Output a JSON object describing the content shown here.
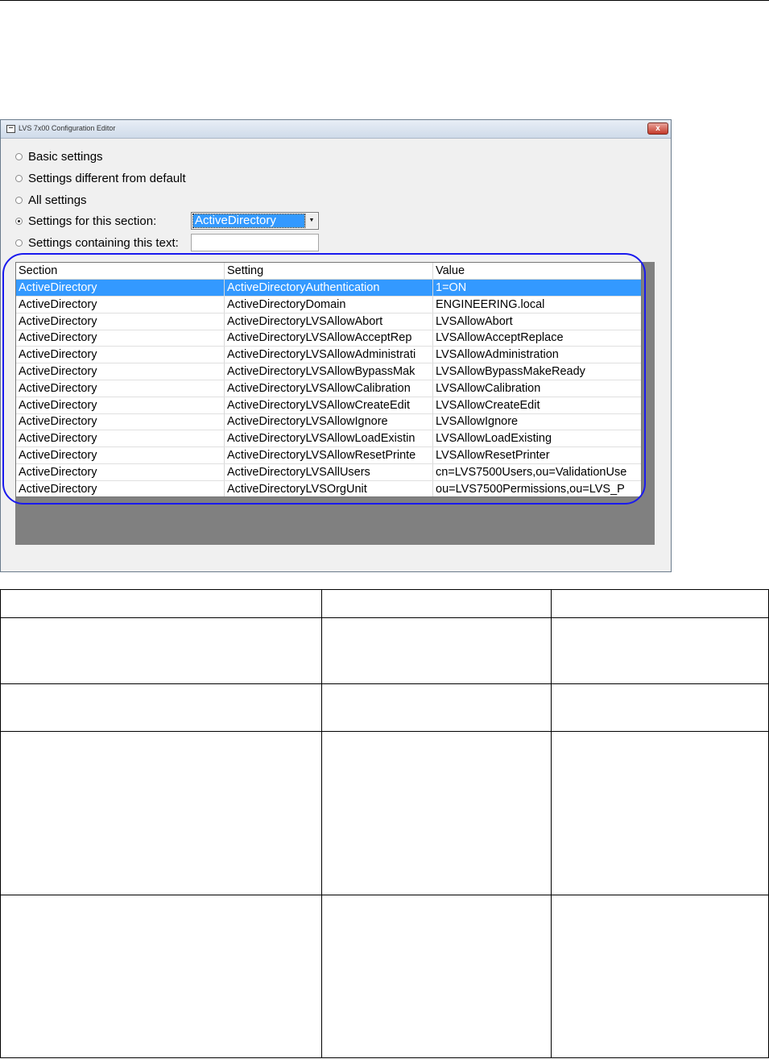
{
  "window": {
    "title": "LVS 7x00 Configuration Editor",
    "close_symbol": "x"
  },
  "filter_options": [
    {
      "label": "Basic settings",
      "checked": false
    },
    {
      "label": "Settings different from default",
      "checked": false
    },
    {
      "label": "All settings",
      "checked": false
    },
    {
      "label": "Settings for this section:",
      "checked": true
    },
    {
      "label": "Settings containing this text:",
      "checked": false
    }
  ],
  "section_combo": {
    "value": "ActiveDirectory",
    "arrow_icon": "dropdown-arrow-icon"
  },
  "text_filter": {
    "value": ""
  },
  "grid": {
    "columns": [
      "Section",
      "Setting",
      "Value"
    ],
    "rows": [
      [
        "ActiveDirectory",
        "ActiveDirectoryAuthentication",
        "1=ON"
      ],
      [
        "ActiveDirectory",
        "ActiveDirectoryDomain",
        "ENGINEERING.local"
      ],
      [
        "ActiveDirectory",
        "ActiveDirectoryLVSAllowAbort",
        "LVSAllowAbort"
      ],
      [
        "ActiveDirectory",
        "ActiveDirectoryLVSAllowAcceptRep",
        "LVSAllowAcceptReplace"
      ],
      [
        "ActiveDirectory",
        "ActiveDirectoryLVSAllowAdministrati",
        "LVSAllowAdministration"
      ],
      [
        "ActiveDirectory",
        "ActiveDirectoryLVSAllowBypassMak",
        "LVSAllowBypassMakeReady"
      ],
      [
        "ActiveDirectory",
        "ActiveDirectoryLVSAllowCalibration",
        "LVSAllowCalibration"
      ],
      [
        "ActiveDirectory",
        "ActiveDirectoryLVSAllowCreateEdit",
        "LVSAllowCreateEdit"
      ],
      [
        "ActiveDirectory",
        "ActiveDirectoryLVSAllowIgnore",
        "LVSAllowIgnore"
      ],
      [
        "ActiveDirectory",
        "ActiveDirectoryLVSAllowLoadExistin",
        "LVSAllowLoadExisting"
      ],
      [
        "ActiveDirectory",
        "ActiveDirectoryLVSAllowResetPrinte",
        "LVSAllowResetPrinter"
      ],
      [
        "ActiveDirectory",
        "ActiveDirectoryLVSAllUsers",
        "cn=LVS7500Users,ou=ValidationUse"
      ],
      [
        "ActiveDirectory",
        "ActiveDirectoryLVSOrgUnit",
        "ou=LVS7500Permissions,ou=LVS_P"
      ]
    ],
    "selected_row": 0
  },
  "colors": {
    "selection": "#3399ff",
    "highlight_oval": "#1a1aee",
    "grid_background": "#808080"
  }
}
